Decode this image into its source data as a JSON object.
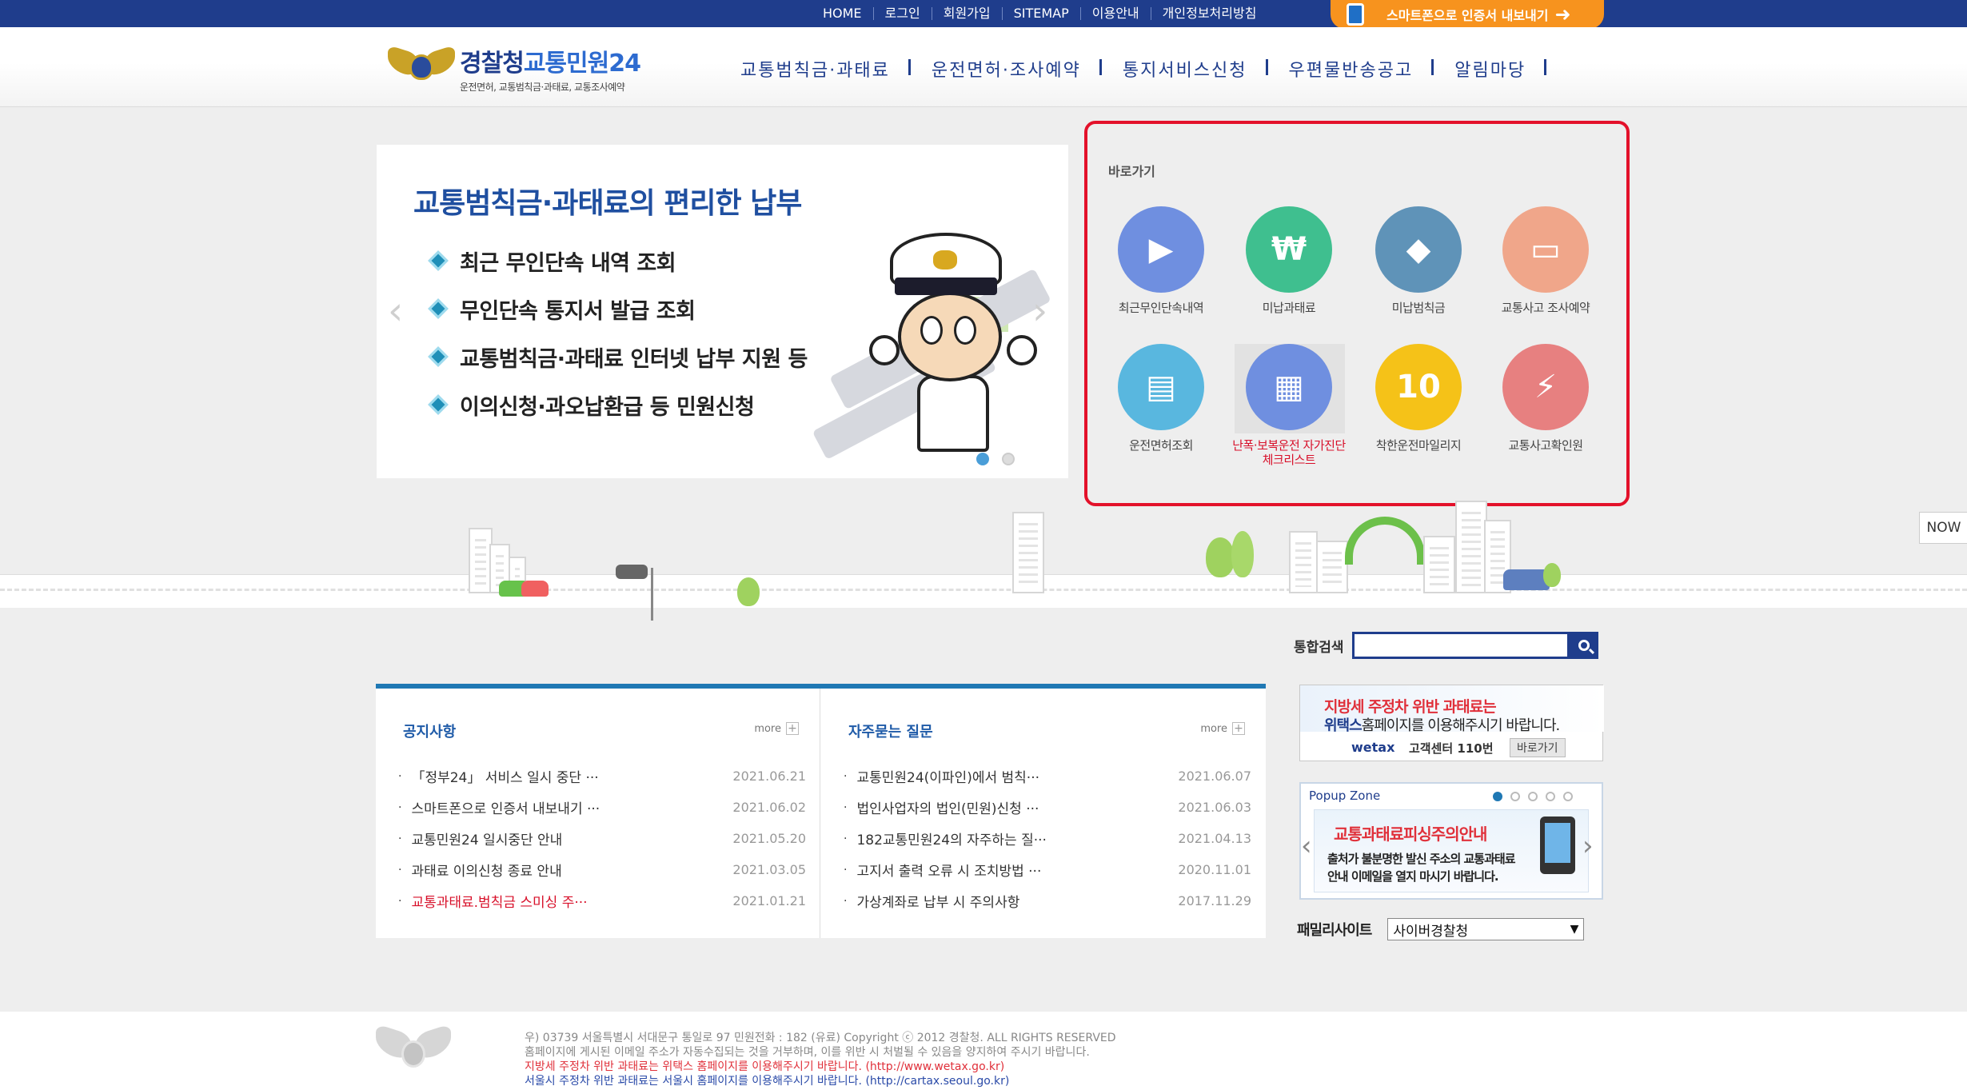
{
  "topnav": {
    "links": [
      "HOME",
      "로그인",
      "회원가입",
      "SITEMAP",
      "이용안내",
      "개인정보처리방침"
    ],
    "smart_button": "스마트폰으로 인증서 내보내기"
  },
  "header": {
    "logo_title_1": "경찰청",
    "logo_title_2": "교통민원24",
    "logo_subtitle": "운전면허, 교통범칙금·과태료, 교통조사예약",
    "gnb": [
      "교통범칙금·과태료",
      "운전면허·조사예약",
      "통지서비스신청",
      "우편물반송공고",
      "알림마당"
    ]
  },
  "banner": {
    "title": "교통범칙금·과태료의 편리한 납부",
    "items": [
      "최근 무인단속 내역 조회",
      "무인단속 통지서 발급 조회",
      "교통범칙금·과태료 인터넷 납부 지원 등",
      "이의신청·과오납환급 등 민원신청"
    ],
    "slide_count": 2,
    "active_slide": 1
  },
  "quick": {
    "title": "바로가기",
    "items": [
      {
        "label": "최근무인단속내역",
        "icon": "camera-icon",
        "color": "#6f8fe0"
      },
      {
        "label": "미납과태료",
        "icon": "money-icon",
        "color": "#3fbf8f"
      },
      {
        "label": "미납범칙금",
        "icon": "warning-icon",
        "color": "#5f93b8"
      },
      {
        "label": "교통사고 조사예약",
        "icon": "computer-icon",
        "color": "#f0a68a"
      },
      {
        "label": "운전면허조회",
        "icon": "license-card-icon",
        "color": "#59b7df"
      },
      {
        "label": "난폭·보복운전 자가진단 체크리스트",
        "icon": "calendar-check-icon",
        "color": "#6f8fe0",
        "highlight": true
      },
      {
        "label": "착한운전마일리지",
        "icon": "mileage-car-icon",
        "color": "#f5c218"
      },
      {
        "label": "교통사고확인원",
        "icon": "car-accident-icon",
        "color": "#e78080"
      }
    ]
  },
  "now_tab": "NOW",
  "notice": {
    "title": "공지사항",
    "more": "more",
    "rows": [
      {
        "title": "「정부24」 서비스 일시 중단 ···",
        "date": "2021.06.21"
      },
      {
        "title": "스마트폰으로 인증서 내보내기 ···",
        "date": "2021.06.02"
      },
      {
        "title": "교통민원24 일시중단 안내",
        "date": "2021.05.20"
      },
      {
        "title": "과태료 이의신청 종료 안내",
        "date": "2021.03.05"
      },
      {
        "title": "교통과태료.범칙금 스미싱 주···",
        "date": "2021.01.21",
        "red": true
      }
    ]
  },
  "faq": {
    "title": "자주묻는 질문",
    "more": "more",
    "rows": [
      {
        "title": "교통민원24(이파인)에서 범칙···",
        "date": "2021.06.07"
      },
      {
        "title": "법인사업자의 법인(민원)신청 ···",
        "date": "2021.06.03"
      },
      {
        "title": "182교통민원24의 자주하는 질···",
        "date": "2021.04.13"
      },
      {
        "title": "고지서 출력 오류 시 조치방법 ···",
        "date": "2020.11.01"
      },
      {
        "title": "가상계좌로 납부 시 주의사항",
        "date": "2017.11.29"
      }
    ]
  },
  "search": {
    "label": "통합검색",
    "value": ""
  },
  "wetax": {
    "line1": "지방세 주정차 위반 과태료는",
    "line2_bold": "위택스",
    "line2_rest": "홈페이지를 이용해주시기 바랍니다.",
    "logo": "wetax",
    "center": "고객센터 110번",
    "button": "바로가기"
  },
  "popup": {
    "title": "Popup Zone",
    "dot_count": 5,
    "active_dot": 1,
    "headline": "교통과태료피싱주의안내",
    "sub1": "출처가 불분명한 발신 주소의 교통과태료",
    "sub2": "안내 이메일을 열지 마시기 바랍니다."
  },
  "family": {
    "label": "패밀리사이트",
    "selected": "사이버경찰청"
  },
  "footer": {
    "line1": "우) 03739 서울특별시 서대문구 통일로 97   민원전화 : 182 (유료)        Copyright ⓒ 2012 경찰청. ALL RIGHTS RESERVED",
    "line2": "홈페이지에 게시된 이메일 주소가 자동수집되는 것을 거부하며, 이를 위반 시 처벌될 수 있음을 양지하여 주시기 바랍니다.",
    "line3": "지방세 주정차 위반 과태료는 위택스 홈페이지를 이용해주시기 바랍니다. (http://www.wetax.go.kr)",
    "line4": "서울시 주정차 위반 과태료는 서울시 홈페이지를 이용해주시기 바랍니다. (http://cartax.seoul.go.kr)"
  }
}
